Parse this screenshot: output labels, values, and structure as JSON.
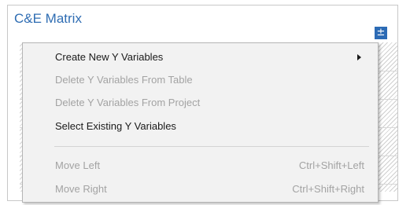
{
  "header": {
    "title": "C&E Matrix",
    "expand_button": "±"
  },
  "context_menu": {
    "items": [
      {
        "label": "Create New Y Variables",
        "enabled": true,
        "has_submenu": true
      },
      {
        "label": "Delete Y Variables From Table",
        "enabled": false
      },
      {
        "label": "Delete Y Variables From Project",
        "enabled": false
      },
      {
        "label": "Select Existing Y Variables",
        "enabled": true
      },
      {
        "label": "Move Left",
        "enabled": false,
        "shortcut": "Ctrl+Shift+Left"
      },
      {
        "label": "Move Right",
        "enabled": false,
        "shortcut": "Ctrl+Shift+Right"
      }
    ]
  },
  "colors": {
    "title": "#2f6db3",
    "accent_button": "#2c6bb5",
    "menu_background": "#f2f2f2",
    "disabled_text": "#a3a3a3"
  }
}
